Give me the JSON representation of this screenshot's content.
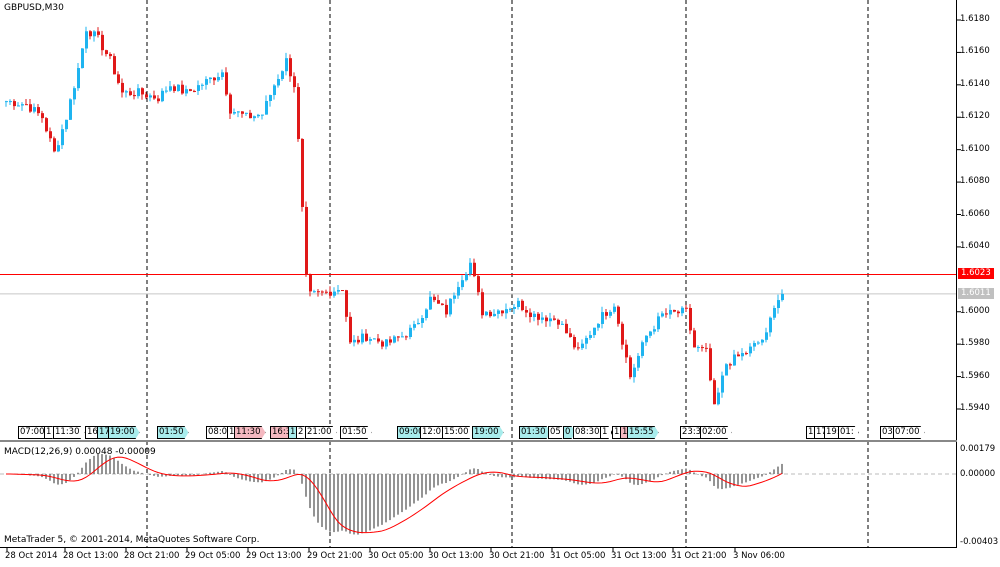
{
  "symbol_label": "GBPUSD,M30",
  "macd_label": "MACD(12,26,9) 0.00048 -0.00009",
  "copyright": "MetaTrader 5, © 2001-2014, MetaQuotes Software Corp.",
  "colors": {
    "bull": "#1eb4f0",
    "bear": "#e01818",
    "bid_line": "#ff0000",
    "ask_line": "#c8c8c8",
    "macd_hist": "#707070",
    "signal": "#ff0000"
  },
  "price_axis": [
    "1.6180",
    "1.6160",
    "1.6140",
    "1.6120",
    "1.6100",
    "1.6080",
    "1.6060",
    "1.6040",
    "1.6000",
    "1.5980",
    "1.5960",
    "1.5940"
  ],
  "bid_price": "1.6023",
  "ask_price": "1.6011",
  "macd_axis": {
    "top": "0.00179",
    "zero": "0.00000",
    "bottom": "-0.00403"
  },
  "time_axis": [
    "28 Oct 2014",
    "28 Oct 13:00",
    "28 Oct 21:00",
    "29 Oct 05:00",
    "29 Oct 13:00",
    "29 Oct 21:00",
    "30 Oct 05:00",
    "30 Oct 13:00",
    "30 Oct 21:00",
    "31 Oct 05:00",
    "31 Oct 13:00",
    "31 Oct 21:00",
    "3 Nov 06:00"
  ],
  "events": [
    {
      "label": "07:00",
      "c": "w"
    },
    {
      "label": "1",
      "c": "w"
    },
    {
      "label": "11:30",
      "c": "w"
    },
    {
      "label": "16",
      "c": "w"
    },
    {
      "label": "17",
      "c": "b"
    },
    {
      "label": "19:00",
      "c": "b"
    },
    {
      "label": "01:50",
      "c": "b"
    },
    {
      "label": "08:00",
      "c": "w"
    },
    {
      "label": "1",
      "c": "w"
    },
    {
      "label": "11:30",
      "c": "r"
    },
    {
      "label": "16:3",
      "c": "r"
    },
    {
      "label": "1",
      "c": "b"
    },
    {
      "label": "2",
      "c": "w"
    },
    {
      "label": "21:00",
      "c": "w"
    },
    {
      "label": "01:50",
      "c": "w"
    },
    {
      "label": "09:00",
      "c": "b"
    },
    {
      "label": "12:0",
      "c": "w"
    },
    {
      "label": "15:00",
      "c": "w"
    },
    {
      "label": "19:00",
      "c": "b"
    },
    {
      "label": "01:30",
      "c": "b"
    },
    {
      "label": "05",
      "c": "w"
    },
    {
      "label": "0",
      "c": "b"
    },
    {
      "label": "08:30",
      "c": "w"
    },
    {
      "label": "1",
      "c": "w"
    },
    {
      "label": "13",
      "c": "w"
    },
    {
      "label": "1",
      "c": "r"
    },
    {
      "label": "15:55",
      "c": "b"
    },
    {
      "label": "23:3",
      "c": "w"
    },
    {
      "label": "02:00",
      "c": "w"
    },
    {
      "label": "1",
      "c": "w"
    },
    {
      "label": "17",
      "c": "w"
    },
    {
      "label": "19:40",
      "c": "w"
    },
    {
      "label": "01:",
      "c": "w"
    },
    {
      "label": "03:35",
      "c": "w"
    },
    {
      "label": "07:00",
      "c": "w"
    }
  ],
  "candle_anchors": [
    [
      0,
      1.613
    ],
    [
      5,
      1.6128
    ],
    [
      9,
      1.612
    ],
    [
      12,
      1.6098
    ],
    [
      15,
      1.612
    ],
    [
      18,
      1.615
    ],
    [
      20,
      1.6175
    ],
    [
      23,
      1.6168
    ],
    [
      26,
      1.6155
    ],
    [
      29,
      1.6135
    ],
    [
      33,
      1.6135
    ],
    [
      38,
      1.6132
    ],
    [
      41,
      1.614
    ],
    [
      45,
      1.6135
    ],
    [
      50,
      1.6142
    ],
    [
      54,
      1.6148
    ],
    [
      56,
      1.6125
    ],
    [
      60,
      1.612
    ],
    [
      64,
      1.6122
    ],
    [
      67,
      1.614
    ],
    [
      70,
      1.6155
    ],
    [
      72,
      1.614
    ],
    [
      73,
      1.6105
    ],
    [
      75,
      1.602
    ],
    [
      76,
      1.601
    ],
    [
      80,
      1.6012
    ],
    [
      84,
      1.6015
    ],
    [
      86,
      1.598
    ],
    [
      90,
      1.5985
    ],
    [
      95,
      1.598
    ],
    [
      99,
      1.5985
    ],
    [
      102,
      1.599
    ],
    [
      106,
      1.6008
    ],
    [
      110,
      1.6
    ],
    [
      113,
      1.6018
    ],
    [
      116,
      1.603
    ],
    [
      119,
      1.6
    ],
    [
      122,
      1.6
    ],
    [
      128,
      1.6005
    ],
    [
      132,
      1.5998
    ],
    [
      138,
      1.5995
    ],
    [
      143,
      1.5975
    ],
    [
      148,
      1.5995
    ],
    [
      152,
      1.6005
    ],
    [
      156,
      1.596
    ],
    [
      160,
      1.5985
    ],
    [
      164,
      1.5998
    ],
    [
      170,
      1.6
    ],
    [
      172,
      1.5978
    ],
    [
      175,
      1.5975
    ],
    [
      177,
      1.594
    ],
    [
      180,
      1.5968
    ],
    [
      185,
      1.5975
    ],
    [
      190,
      1.5985
    ],
    [
      192,
      1.6005
    ],
    [
      194,
      1.6011
    ]
  ]
}
